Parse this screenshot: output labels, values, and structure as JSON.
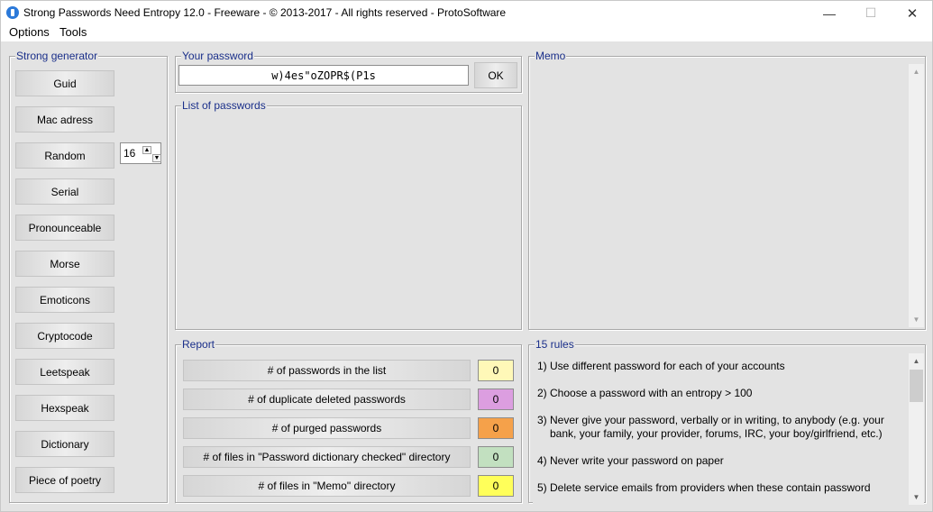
{
  "window": {
    "title": "Strong Passwords Need Entropy 12.0 - Freeware - © 2013-2017 - All rights reserved - ProtoSoftware",
    "minimize": "—",
    "maximize": "☐",
    "close": "✕"
  },
  "menu": {
    "options": "Options",
    "tools": "Tools"
  },
  "generator": {
    "caption": "Strong generator",
    "buttons": [
      "Guid",
      "Mac adress",
      "Random",
      "Serial",
      "Pronounceable",
      "Morse",
      "Emoticons",
      "Cryptocode",
      "Leetspeak",
      "Hexspeak",
      "Dictionary",
      "Piece of poetry"
    ],
    "random_length": "16"
  },
  "password": {
    "caption": "Your password",
    "value": "w)4es\"oZOPR$(P1s",
    "ok_label": "OK"
  },
  "list": {
    "caption": "List of passwords"
  },
  "memo": {
    "caption": "Memo"
  },
  "report": {
    "caption": "Report",
    "rows": [
      {
        "label": "# of passwords in the list",
        "count": "0",
        "color": "#fff8b8"
      },
      {
        "label": "# of duplicate deleted passwords",
        "count": "0",
        "color": "#dc9ee0"
      },
      {
        "label": "# of purged passwords",
        "count": "0",
        "color": "#f5a14a"
      },
      {
        "label": "# of files in \"Password dictionary checked\" directory",
        "count": "0",
        "color": "#c2e0c0"
      },
      {
        "label": "# of files in \"Memo\" directory",
        "count": "0",
        "color": "#ffff5a"
      }
    ]
  },
  "rules": {
    "caption": "15 rules",
    "items": [
      {
        "line1": "1) Use different password for each of your accounts",
        "line2": ""
      },
      {
        "line1": "2) Choose a password with an entropy > 100",
        "line2": ""
      },
      {
        "line1": "3) Never give your password, verbally or in writing, to anybody (e.g. your",
        "line2": "bank, your family, your provider, forums, IRC, your boy/girlfriend, etc.)"
      },
      {
        "line1": "4) Never write your password on paper",
        "line2": ""
      },
      {
        "line1": "5) Delete service emails from providers when these contain password",
        "line2": ""
      }
    ]
  }
}
